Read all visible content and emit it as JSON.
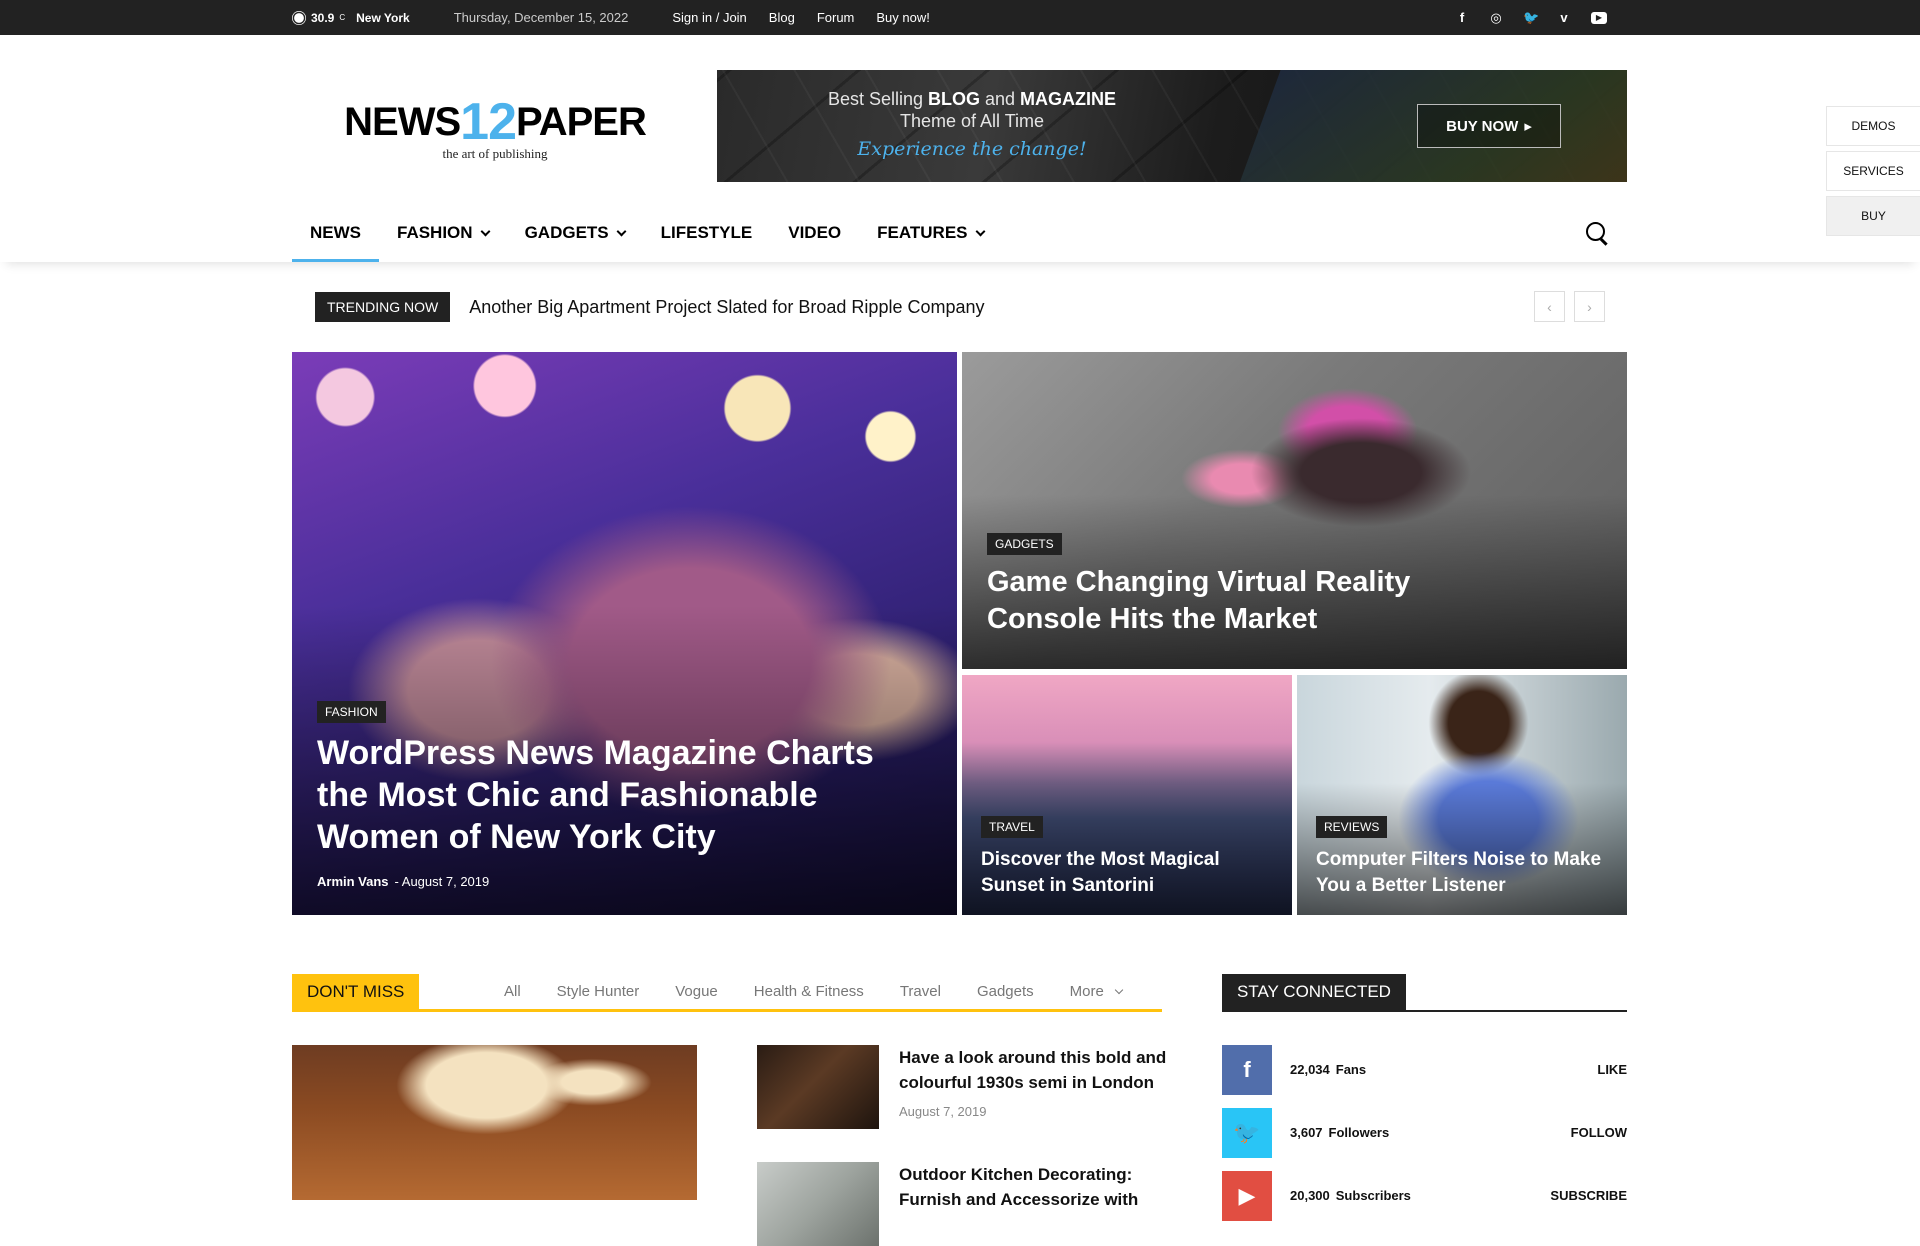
{
  "topbar": {
    "temperature": "30.9",
    "temp_unit": "C",
    "city": "New York",
    "date": "Thursday, December 15, 2022",
    "links": [
      "Sign in / Join",
      "Blog",
      "Forum",
      "Buy now!"
    ],
    "social_icons": [
      "facebook-icon",
      "instagram-icon",
      "twitter-icon",
      "vimeo-icon",
      "youtube-icon"
    ]
  },
  "logo": {
    "part1": "NEWS",
    "num": "12",
    "part2": "PAPER",
    "tagline": "the art of publishing"
  },
  "banner": {
    "line1_a": "Best Selling ",
    "line1_b": "BLOG",
    "line1_c": " and ",
    "line1_d": "MAGAZINE",
    "line2": "Theme of All Time",
    "line3": "Experience the change!",
    "button": "BUY NOW"
  },
  "side_buttons": [
    "DEMOS",
    "SERVICES",
    "BUY"
  ],
  "nav": {
    "items": [
      {
        "label": "NEWS",
        "dropdown": false
      },
      {
        "label": "FASHION",
        "dropdown": true
      },
      {
        "label": "GADGETS",
        "dropdown": true
      },
      {
        "label": "LIFESTYLE",
        "dropdown": false
      },
      {
        "label": "VIDEO",
        "dropdown": false
      },
      {
        "label": "FEATURES",
        "dropdown": true
      }
    ]
  },
  "trending": {
    "label": "TRENDING NOW",
    "text": "Another Big Apartment Project Slated for Broad Ripple Company"
  },
  "featured": {
    "big": {
      "category": "FASHION",
      "title": "WordPress News Magazine Charts the Most Chic and Fashionable Women of New York City",
      "author": "Armin Vans",
      "separator": "-",
      "date": "August 7, 2019"
    },
    "vr": {
      "category": "GADGETS",
      "title": "Game Changing Virtual Reality Console Hits the Market"
    },
    "santorini": {
      "category": "TRAVEL",
      "title": "Discover the Most Magical Sunset in Santorini"
    },
    "review": {
      "category": "REVIEWS",
      "title": "Computer Filters Noise to Make You a Better Listener"
    }
  },
  "dont_miss": {
    "label": "DON'T MISS",
    "tabs": [
      "All",
      "Style Hunter",
      "Vogue",
      "Health & Fitness",
      "Travel",
      "Gadgets",
      "More"
    ],
    "posts": [
      {
        "title": "Have a look around this bold and colourful 1930s semi in London",
        "date": "August 7, 2019"
      },
      {
        "title": "Outdoor Kitchen Decorating: Furnish and Accessorize with",
        "date": ""
      }
    ]
  },
  "stay_connected": {
    "label": "STAY CONNECTED",
    "rows": [
      {
        "icon": "facebook-icon",
        "count": "22,034",
        "unit": "Fans",
        "action": "LIKE",
        "color": "#516eab"
      },
      {
        "icon": "twitter-icon",
        "count": "3,607",
        "unit": "Followers",
        "action": "FOLLOW",
        "color": "#29c5f6"
      },
      {
        "icon": "youtube-icon",
        "count": "20,300",
        "unit": "Subscribers",
        "action": "SUBSCRIBE",
        "color": "#e14e42"
      }
    ]
  }
}
